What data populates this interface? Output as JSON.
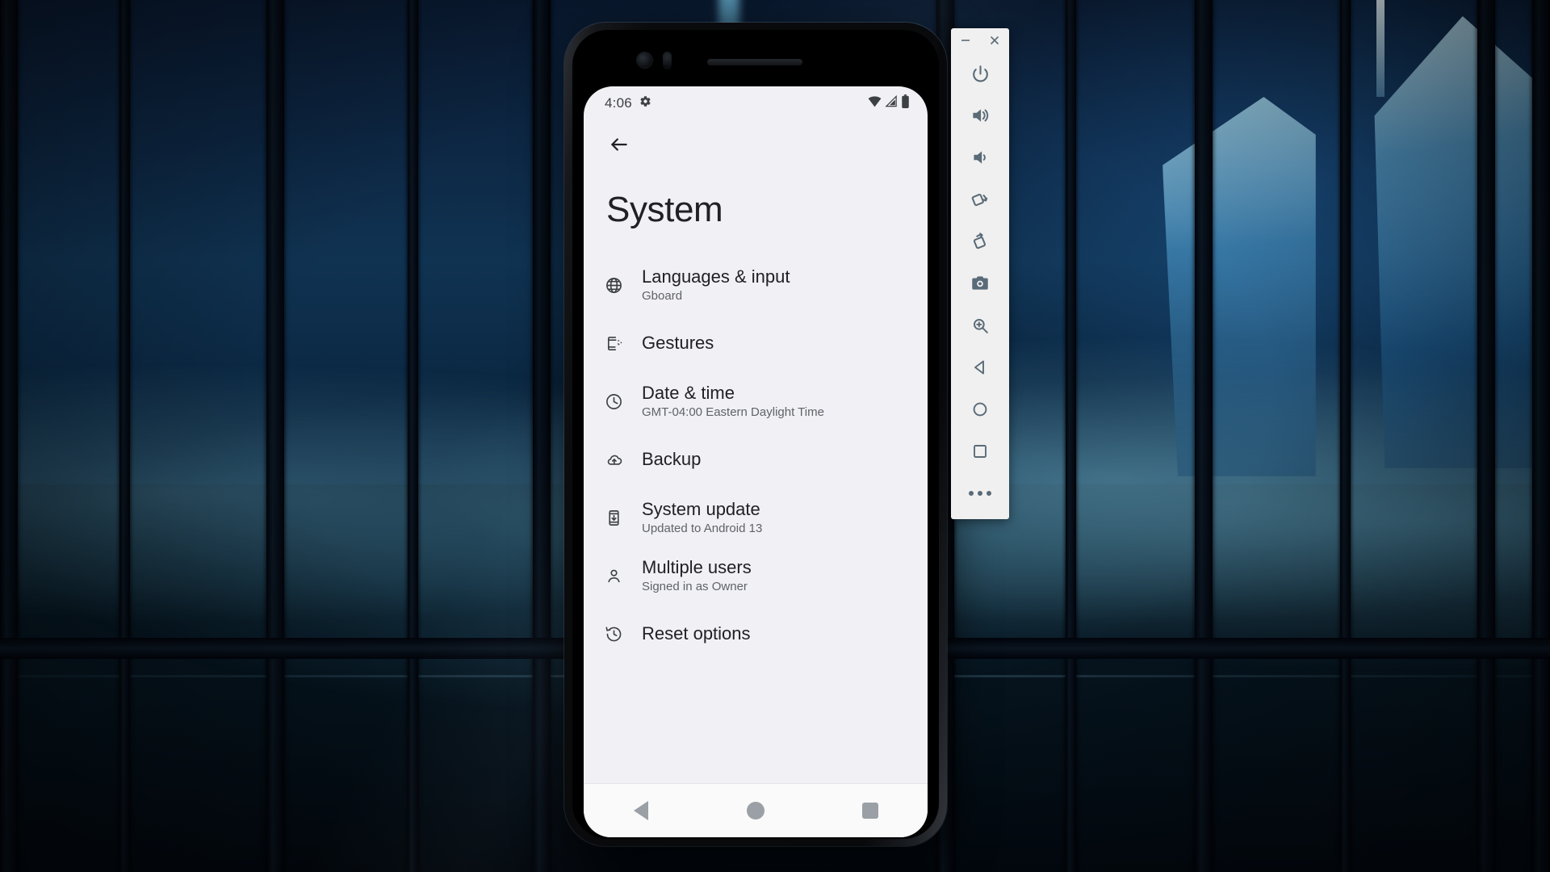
{
  "background": {
    "description": "night-cityscape-through-windows"
  },
  "phone": {
    "statusbar": {
      "time": "4:06",
      "settings_icon": "gear-icon",
      "wifi_icon": "wifi-icon",
      "signal_icon": "cellular-signal-icon",
      "battery_icon": "battery-icon"
    },
    "back_button": "back-arrow-icon",
    "title": "System",
    "items": [
      {
        "icon": "globe-icon",
        "title": "Languages & input",
        "subtitle": "Gboard"
      },
      {
        "icon": "gesture-phone-icon",
        "title": "Gestures",
        "subtitle": ""
      },
      {
        "icon": "clock-icon",
        "title": "Date & time",
        "subtitle": "GMT-04:00 Eastern Daylight Time"
      },
      {
        "icon": "cloud-upload-icon",
        "title": "Backup",
        "subtitle": ""
      },
      {
        "icon": "system-update-icon",
        "title": "System update",
        "subtitle": "Updated to Android 13"
      },
      {
        "icon": "person-icon",
        "title": "Multiple users",
        "subtitle": "Signed in as Owner"
      },
      {
        "icon": "history-restore-icon",
        "title": "Reset options",
        "subtitle": ""
      }
    ],
    "navbar": {
      "back": "nav-back-triangle",
      "home": "nav-home-circle",
      "recents": "nav-recents-square"
    }
  },
  "toolbar": {
    "minimize": "minimize-icon",
    "close": "close-icon",
    "buttons": [
      {
        "name": "power-icon"
      },
      {
        "name": "volume-up-icon"
      },
      {
        "name": "volume-down-icon"
      },
      {
        "name": "rotate-left-icon"
      },
      {
        "name": "rotate-right-icon"
      },
      {
        "name": "screenshot-camera-icon"
      },
      {
        "name": "zoom-in-icon"
      },
      {
        "name": "back-triangle-icon"
      },
      {
        "name": "home-circle-icon"
      },
      {
        "name": "recents-square-icon"
      },
      {
        "name": "more-options-icon"
      }
    ]
  },
  "colors": {
    "screen_bg": "#f1f0f4",
    "text_primary": "#202124",
    "text_secondary": "#5f6368",
    "toolbar_bg": "#f0f0f0",
    "toolbar_icon": "#5a6b78",
    "nav_icon": "#9aa0a6"
  }
}
